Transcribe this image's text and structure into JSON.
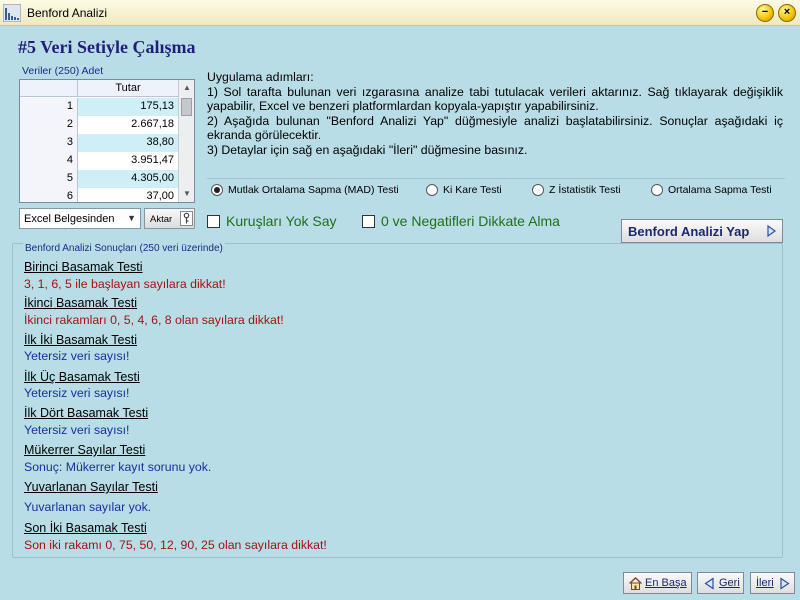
{
  "window": {
    "title": "Benford Analizi"
  },
  "page_title": "#5 Veri Setiyle Çalışma",
  "grid": {
    "label": "Veriler (250) Adet",
    "column_header": "Tutar",
    "rows": [
      {
        "n": "1",
        "value": "175,13"
      },
      {
        "n": "2",
        "value": "2.667,18"
      },
      {
        "n": "3",
        "value": "38,80"
      },
      {
        "n": "4",
        "value": "3.951,47"
      },
      {
        "n": "5",
        "value": "4.305,00"
      },
      {
        "n": "6",
        "value": "37,00"
      }
    ]
  },
  "source_select": {
    "value": "Excel Belgesinden"
  },
  "aktar_button": "Aktar",
  "instructions": [
    "Uygulama adımları:",
    "1) Sol tarafta bulunan veri ızgarasına analize tabi tutulacak verileri aktarınız. Sağ tıklayarak değişiklik yapabilir, Excel ve benzeri platformlardan kopyala-yapıştır yapabilirsiniz.",
    "2) Aşağıda bulunan \"Benford Analizi Yap\" düğmesiyle analizi başlatabilirsiniz. Sonuçlar aşağıdaki iç ekranda görülecektir.",
    "3) Detaylar için sağ en aşağıdaki \"İleri\" düğmesine basınız."
  ],
  "tests": [
    {
      "label": "Mutlak Ortalama Sapma (MAD) Testi",
      "selected": true
    },
    {
      "label": "Ki Kare Testi",
      "selected": false
    },
    {
      "label": "Z İstatistik Testi",
      "selected": false
    },
    {
      "label": "Ortalama Sapma Testi",
      "selected": false
    }
  ],
  "options": {
    "ignore_cents": "Kuruşları Yok Say",
    "ignore_zero_negative": "0 ve Negatifleri Dikkate Alma"
  },
  "analyze_button": "Benford Analizi Yap",
  "results": {
    "label": "Benford Analizi Sonuçları (250 veri üzerinde)",
    "items": [
      {
        "heading": "Birinci Basamak Testi",
        "text": "3, 1, 6, 5 ile başlayan sayılara dikkat!",
        "tone": "red"
      },
      {
        "heading": "İkinci Basamak Testi",
        "text": "İkinci rakamları 0, 5, 4, 6, 8 olan sayılara dikkat!",
        "tone": "red"
      },
      {
        "heading": "İlk İki Basamak Testi",
        "text": "Yetersiz veri sayısı!",
        "tone": "blue"
      },
      {
        "heading": "İlk Üç Basamak Testi",
        "text": "Yetersiz veri sayısı!",
        "tone": "blue"
      },
      {
        "heading": "İlk Dört Basamak Testi",
        "text": "Yetersiz veri sayısı!",
        "tone": "blue"
      },
      {
        "heading": "Mükerrer Sayılar Testi",
        "text": "Sonuç:  Mükerrer kayıt sorunu yok.",
        "tone": "blue"
      },
      {
        "heading": "Yuvarlanan Sayılar Testi",
        "text": "Yuvarlanan sayılar yok.",
        "tone": "blue"
      },
      {
        "heading": "Son İki Basamak Testi",
        "text": "Son iki rakamı 0, 75, 50, 12, 90, 25 olan sayılara dikkat!",
        "tone": "red"
      }
    ]
  },
  "nav": {
    "home": "En Başa",
    "back": "Geri",
    "next": "İleri"
  },
  "colors": {
    "background": "#b9dde6",
    "title": "#1f1f7a",
    "alert": "#a21212",
    "info": "#1b2e9c",
    "option_text": "#1d6f1d"
  }
}
